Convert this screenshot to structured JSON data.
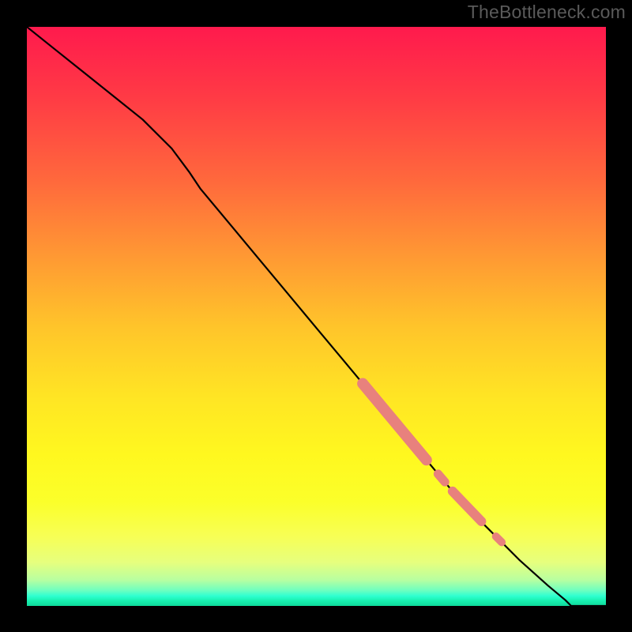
{
  "attribution": "TheBottleneck.com",
  "chart_data": {
    "type": "line",
    "title": "",
    "xlabel": "",
    "ylabel": "",
    "xlim": [
      0,
      100
    ],
    "ylim": [
      0,
      100
    ],
    "series": [
      {
        "name": "curve",
        "x": [
          0,
          5,
          10,
          15,
          20,
          25,
          28,
          30,
          35,
          40,
          45,
          50,
          55,
          60,
          65,
          70,
          75,
          80,
          85,
          90,
          93,
          94,
          100
        ],
        "values": [
          100,
          96,
          92,
          88,
          84,
          79,
          75,
          72,
          66,
          60,
          54,
          48,
          42,
          36,
          30,
          24,
          18,
          13,
          8,
          3.5,
          1,
          0,
          0
        ]
      }
    ],
    "highlighted_segments": [
      {
        "name": "segment-a",
        "x0": 58,
        "y0": 38.4,
        "x1": 69,
        "y1": 25.2
      },
      {
        "name": "segment-b",
        "x0": 71,
        "y0": 22.8,
        "x1": 72.2,
        "y1": 21.4
      },
      {
        "name": "segment-c",
        "x0": 73.5,
        "y0": 19.8,
        "x1": 78.5,
        "y1": 14.6
      },
      {
        "name": "segment-d",
        "x0": 81,
        "y0": 12,
        "x1": 82,
        "y1": 11
      }
    ],
    "gradient_stops": [
      {
        "pos": 0.0,
        "color": "#ff1a4d"
      },
      {
        "pos": 0.5,
        "color": "#ffd828"
      },
      {
        "pos": 0.8,
        "color": "#fdff30"
      },
      {
        "pos": 0.97,
        "color": "#6effc0"
      },
      {
        "pos": 1.0,
        "color": "#0fd99b"
      }
    ],
    "line_color": "#000000",
    "highlight_color": "#e8817d"
  }
}
